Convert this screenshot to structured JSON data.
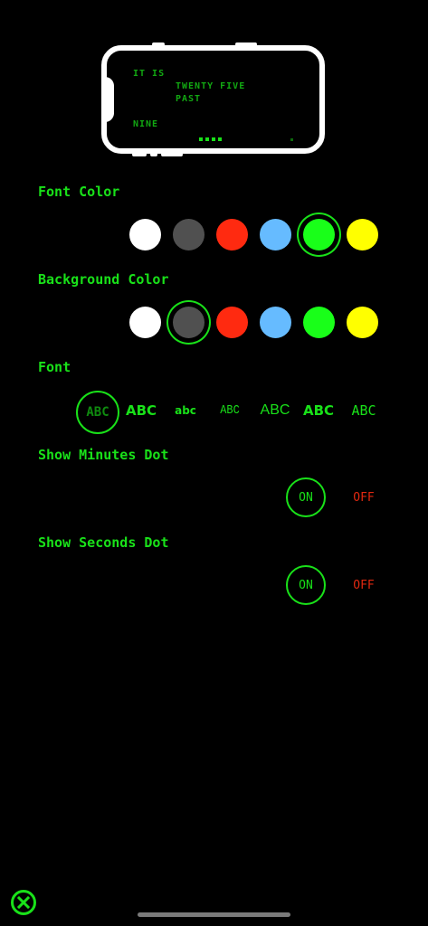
{
  "preview": {
    "line1": "IT IS",
    "line2": "TWENTY FIVE",
    "line3": "PAST",
    "line4": "NINE"
  },
  "font_color": {
    "label": "Font Color",
    "options": [
      "#ffffff",
      "#505050",
      "#ff2a10",
      "#66bbff",
      "#19ff19",
      "#ffff00"
    ],
    "selected_index": 4
  },
  "background_color": {
    "label": "Background Color",
    "options": [
      "#ffffff",
      "#505050",
      "#ff2a10",
      "#66bbff",
      "#19ff19",
      "#ffff00"
    ],
    "selected_index": 1
  },
  "font": {
    "label": "Font",
    "options": [
      "ABC",
      "ABC",
      "abc",
      "ABC",
      "ABC",
      "ABC",
      "ABC"
    ],
    "selected_index": 0
  },
  "show_minutes_dot": {
    "label": "Show Minutes Dot",
    "on_label": "ON",
    "off_label": "OFF",
    "selected": "ON"
  },
  "show_seconds_dot": {
    "label": "Show Seconds Dot",
    "on_label": "ON",
    "off_label": "OFF",
    "selected": "ON"
  },
  "icons": {
    "close": "close-icon"
  },
  "colors": {
    "accent": "#19e119",
    "off": "#e02810",
    "background": "#000000"
  }
}
